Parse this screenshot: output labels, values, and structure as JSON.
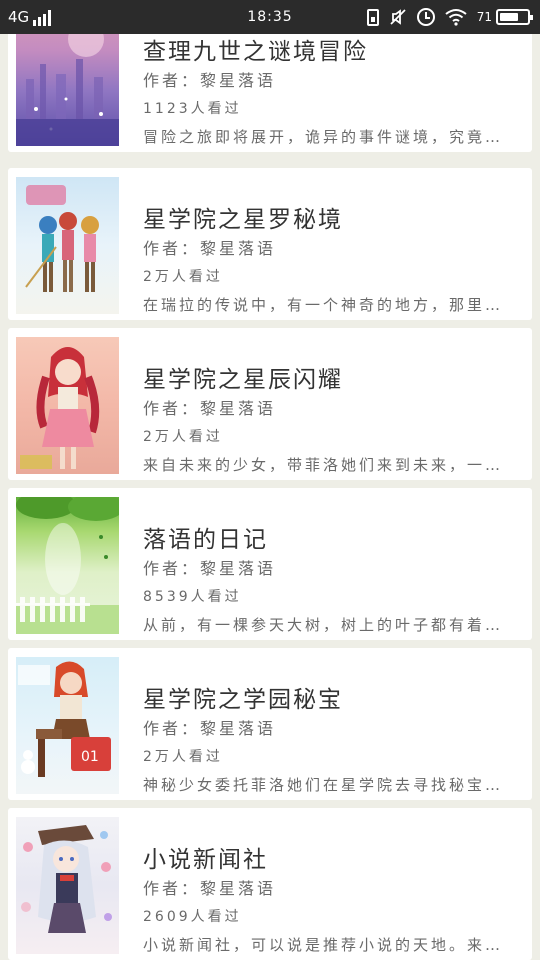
{
  "status_bar": {
    "network": "4G",
    "time": "18:35",
    "battery_percent": "71",
    "battery_level": 0.71
  },
  "books": [
    {
      "title": "查理九世之谜境冒险",
      "author": "作者：黎星落语",
      "views": "1123人看过",
      "description": "冒险之旅即将展开，诡异的事件谜境，究竟…",
      "cover_icon": "cover-fantasy-city"
    },
    {
      "title": "星学院之星罗秘境",
      "author": "作者：黎星落语",
      "views": "2万人看过",
      "description": "在瑞拉的传说中，有一个神奇的地方，那里…",
      "cover_icon": "cover-three-girls"
    },
    {
      "title": "星学院之星辰闪耀",
      "author": "作者：黎星落语",
      "views": "2万人看过",
      "description": "来自未来的少女，带菲洛她们来到未来，一…",
      "cover_icon": "cover-red-hair-girl"
    },
    {
      "title": "落语的日记",
      "author": "作者：黎星落语",
      "views": "8539人看过",
      "description": "从前，有一棵参天大树，树上的叶子都有着…",
      "cover_icon": "cover-green-diary"
    },
    {
      "title": "星学院之学园秘宝",
      "author": "作者：黎星落语",
      "views": "2万人看过",
      "description": "神秘少女委托菲洛她们在星学院去寻找秘宝…",
      "cover_icon": "cover-girl-sitting"
    },
    {
      "title": "小说新闻社",
      "author": "作者：黎星落语",
      "views": "2609人看过",
      "description": "小说新闻社，可以说是推荐小说的天地。来…",
      "cover_icon": "cover-anime-silver-hair"
    }
  ]
}
